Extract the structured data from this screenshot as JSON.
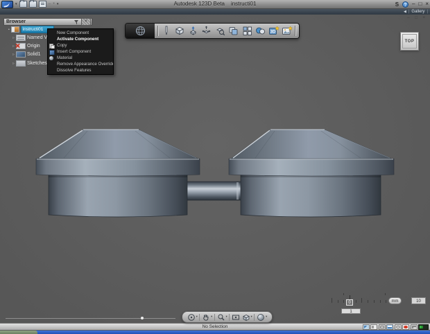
{
  "titlebar": {
    "app_title": "Autodesk 123D Beta",
    "doc_title": "instructi01"
  },
  "glyphs": {
    "dropdown": "▾",
    "collapse_left": "◀",
    "pipe": "|",
    "expander": "▹",
    "bullet": "•",
    "minimize": "–",
    "maximize": "□",
    "close": "×",
    "help": "?",
    "sync": "S",
    "undo_dash": "–",
    "redo_dot": "•",
    "doc_controls": "– □ ×",
    "browser_close": "×"
  },
  "quick_access_icons": [
    "app-logo",
    "open-folder-icon",
    "import-icon",
    "save-stack-icon",
    "undo-icon",
    "redo-icon"
  ],
  "gallery_bar": {
    "label": "Gallery"
  },
  "browser": {
    "header": "Browser",
    "nodes": [
      {
        "label": "instructi01",
        "icon": "component-icon",
        "selected": true
      },
      {
        "label": "Named Views",
        "icon": "named-views-icon"
      },
      {
        "label": "Origin",
        "icon": "origin-icon",
        "visibility": "hidden-red-x"
      },
      {
        "label": "Solid1",
        "icon": "solid-icon"
      },
      {
        "label": "Sketches",
        "icon": "sketches-icon"
      }
    ]
  },
  "context_menu": {
    "items": [
      {
        "label": "New Component"
      },
      {
        "label": "Activate Component",
        "bold": true
      },
      {
        "label": "Copy",
        "icon": "copy-icon"
      },
      {
        "label": "Insert Component",
        "icon": "insert-component-icon"
      },
      {
        "label": "Material",
        "icon": "material-icon"
      },
      {
        "label": "Remove Appearance Override"
      },
      {
        "label": "Dissolve Features"
      }
    ]
  },
  "toolbar": {
    "menu_icon": "wireframe-sphere-icon",
    "tools": [
      "sketch-pen-icon",
      "primitive-cube-icon",
      "press-pull-icon",
      "move-icon",
      "snap-magnify-icon",
      "combine-icon",
      "pattern-icon",
      "material-spheres-icon",
      "insert-3d-icon",
      "insert-image-icon"
    ]
  },
  "viewcube": {
    "face": "TOP"
  },
  "nav_bar": {
    "tools": [
      "orbit-icon",
      "pan-hand-icon",
      "zoom-icon",
      "look-at-icon",
      "view-style-cube-icon",
      "render-sphere-icon"
    ]
  },
  "scale_widget": {
    "origin": "0",
    "value": "1",
    "unit": "mm",
    "scale": "10"
  },
  "status_bar": {
    "message": "No Selection"
  },
  "colors": {
    "viewport_bg": "#5d5d5d",
    "selection_highlight": "#2f93c0",
    "menu_bg": "#1b1b1b",
    "taskbar_blue": "#2e5fc8",
    "steel_light": "#9aa5b1",
    "steel_dark": "#3a424c",
    "accent_star_yellow": "#f2c330",
    "origin_hidden_red": "#d4341f",
    "help_blue": "#3f7fc1"
  }
}
